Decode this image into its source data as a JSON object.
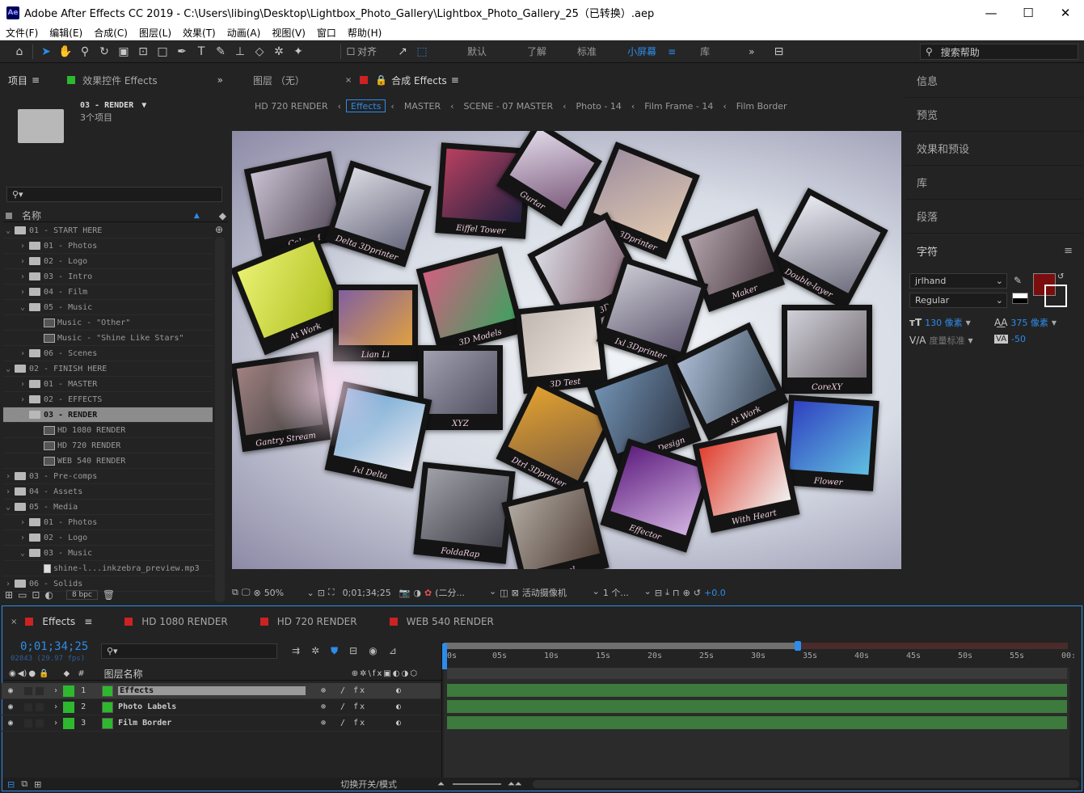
{
  "window": {
    "title": "Adobe After Effects CC 2019 - C:\\Users\\libing\\Desktop\\Lightbox_Photo_Gallery\\Lightbox_Photo_Gallery_25（已转换）.aep",
    "min": "—",
    "max": "☐",
    "close": "✕"
  },
  "menu": [
    "文件(F)",
    "编辑(E)",
    "合成(C)",
    "图层(L)",
    "效果(T)",
    "动画(A)",
    "视图(V)",
    "窗口",
    "帮助(H)"
  ],
  "toolbar": {
    "align_label": "对齐",
    "workspaces": [
      "默认",
      "了解",
      "标准",
      "小屏幕",
      "库"
    ],
    "active_workspace": "小屏幕",
    "help_placeholder": "搜索帮助"
  },
  "project_panel": {
    "tab_project": "项目",
    "tab_effect_controls": "效果控件 Effects",
    "comp_name": "03 - RENDER",
    "comp_info": "3个项目",
    "col_name": "名称",
    "items": [
      {
        "indent": 0,
        "tw": "⌄",
        "type": "folder",
        "label": "01 - START HERE"
      },
      {
        "indent": 1,
        "tw": "›",
        "type": "folder",
        "label": "01 - Photos"
      },
      {
        "indent": 1,
        "tw": "›",
        "type": "folder",
        "label": "02 - Logo"
      },
      {
        "indent": 1,
        "tw": "›",
        "type": "folder",
        "label": "03 - Intro"
      },
      {
        "indent": 1,
        "tw": "›",
        "type": "folder",
        "label": "04 - Film"
      },
      {
        "indent": 1,
        "tw": "⌄",
        "type": "folder",
        "label": "05 - Music"
      },
      {
        "indent": 2,
        "tw": "",
        "type": "comp",
        "label": "Music - \"Other\""
      },
      {
        "indent": 2,
        "tw": "",
        "type": "comp",
        "label": "Music - \"Shine Like Stars\""
      },
      {
        "indent": 1,
        "tw": "›",
        "type": "folder",
        "label": "06 - Scenes"
      },
      {
        "indent": 0,
        "tw": "⌄",
        "type": "folder",
        "label": "02 - FINISH HERE"
      },
      {
        "indent": 1,
        "tw": "›",
        "type": "folder",
        "label": "01 - MASTER"
      },
      {
        "indent": 1,
        "tw": "›",
        "type": "folder",
        "label": "02 - EFFECTS"
      },
      {
        "indent": 1,
        "tw": "⌄",
        "type": "folder",
        "label": "03 - RENDER",
        "selected": true
      },
      {
        "indent": 2,
        "tw": "",
        "type": "comp",
        "label": "HD 1080 RENDER"
      },
      {
        "indent": 2,
        "tw": "",
        "type": "comp",
        "label": "HD 720 RENDER"
      },
      {
        "indent": 2,
        "tw": "",
        "type": "comp",
        "label": "WEB 540 RENDER"
      },
      {
        "indent": 0,
        "tw": "›",
        "type": "folder",
        "label": "03 - Pre-comps"
      },
      {
        "indent": 0,
        "tw": "›",
        "type": "folder",
        "label": "04 - Assets"
      },
      {
        "indent": 0,
        "tw": "⌄",
        "type": "folder",
        "label": "05 - Media"
      },
      {
        "indent": 1,
        "tw": "›",
        "type": "folder",
        "label": "01 - Photos"
      },
      {
        "indent": 1,
        "tw": "›",
        "type": "folder",
        "label": "02 - Logo"
      },
      {
        "indent": 1,
        "tw": "⌄",
        "type": "folder",
        "label": "03 - Music"
      },
      {
        "indent": 2,
        "tw": "",
        "type": "file",
        "label": "shine-l...inkzebra_preview.mp3"
      },
      {
        "indent": 0,
        "tw": "›",
        "type": "folder",
        "label": "06 - Solids"
      }
    ],
    "bpc": "8 bpc"
  },
  "comp_panel": {
    "tab_layer": "图层 （无）",
    "tab_comp": "合成 Effects",
    "breadcrumbs": [
      "HD 720 RENDER",
      "Effects",
      "MASTER",
      "SCENE - 07 MASTER",
      "Photo - 14",
      "Film Frame - 14",
      "Film Border"
    ],
    "active_crumb": "Effects",
    "zoom": "50%",
    "timecode": "0;01;34;25",
    "resolution": "(二分...",
    "camera": "活动摄像机",
    "views": "1 个...",
    "exposure": "+0.0",
    "photos": [
      {
        "label": "Color M"
      },
      {
        "label": "Delta 3Dprinter"
      },
      {
        "label": "Eiffel Tower"
      },
      {
        "label": "Gurtar"
      },
      {
        "label": "Delta 3Dprinter"
      },
      {
        "label": "Double-layer"
      },
      {
        "label": "At Work"
      },
      {
        "label": "3D Models"
      },
      {
        "label": "Delta 3Dprinter"
      },
      {
        "label": "Maker"
      },
      {
        "label": "Lian Li"
      },
      {
        "label": "3D Test"
      },
      {
        "label": "Ixl 3Dprinter"
      },
      {
        "label": "CoreXY"
      },
      {
        "label": "Gantry Stream"
      },
      {
        "label": "XYZ"
      },
      {
        "label": "At Work"
      },
      {
        "label": "Ixl Delta"
      },
      {
        "label": "Dtrl 3Dprinter"
      },
      {
        "label": "Digital Design"
      },
      {
        "label": "Flower"
      },
      {
        "label": "FoldaRap"
      },
      {
        "label": "Effector"
      },
      {
        "label": "With Heart"
      },
      {
        "label": "Excel"
      }
    ]
  },
  "right_panel": {
    "items": [
      "信息",
      "预览",
      "效果和预设",
      "库",
      "段落"
    ],
    "char_title": "字符",
    "font": "jrlhand",
    "style": "Regular",
    "size": "130 像素",
    "leading": "375 像素",
    "kerning": "度量标准",
    "tracking": "-50",
    "fill_color": "#7a0e0e"
  },
  "timeline": {
    "tabs": [
      "Effects",
      "HD 1080 RENDER",
      "HD 720 RENDER",
      "WEB 540 RENDER"
    ],
    "timecode": "0;01;34;25",
    "frames": "02843 (29.97 fps)",
    "col_layer_name": "图层名称",
    "col_num": "#",
    "layers": [
      {
        "num": "1",
        "name": "Effects",
        "selected": true
      },
      {
        "num": "2",
        "name": "Photo Labels",
        "selected": false
      },
      {
        "num": "3",
        "name": "Film Border",
        "selected": false
      }
    ],
    "ruler": [
      "0s",
      "05s",
      "10s",
      "15s",
      "20s",
      "25s",
      "30s",
      "35s",
      "40s",
      "45s",
      "50s",
      "55s",
      "00:"
    ],
    "toggle_label": "切换开关/模式"
  }
}
